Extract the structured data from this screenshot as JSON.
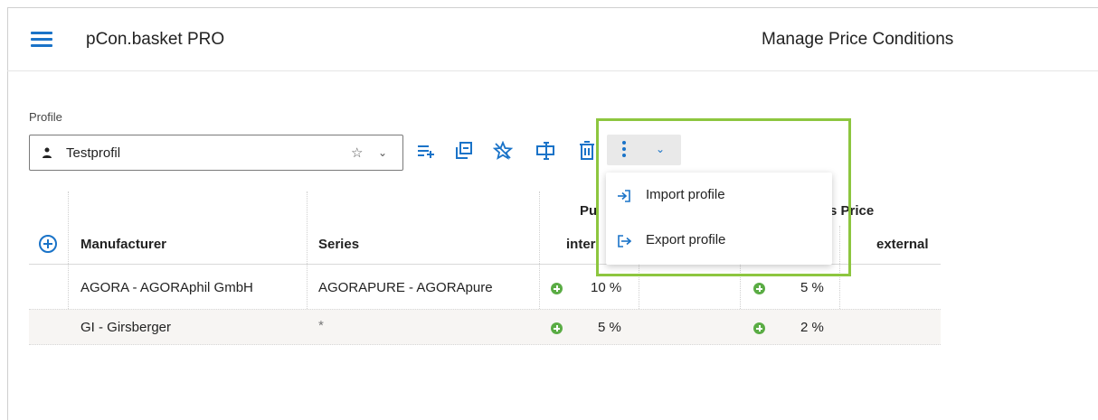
{
  "app": {
    "title": "pCon.basket PRO",
    "page_title": "Manage Price Conditions"
  },
  "profile": {
    "label": "Profile",
    "value": "Testprofil",
    "favorite_glyph": "☆",
    "chevron_glyph": "⌄"
  },
  "toolbar": {
    "more_chevron_glyph": "⌄",
    "icons": [
      "add-list-icon",
      "copy-icon",
      "unfavorite-icon",
      "rename-icon",
      "delete-icon",
      "more-vert-icon"
    ]
  },
  "menu": {
    "items": [
      {
        "label": "Import profile",
        "icon": "import-icon"
      },
      {
        "label": "Export profile",
        "icon": "export-icon"
      }
    ]
  },
  "table": {
    "group_headers": {
      "purchase": "Pu",
      "sales": "s Price"
    },
    "headers": {
      "manufacturer": "Manufacturer",
      "series": "Series",
      "purchase_internal": "inter",
      "sales_external": "external"
    },
    "rows": [
      {
        "manufacturer": "AGORA - AGORAphil GmbH",
        "series": "AGORAPURE - AGORApure",
        "purchase": "10 %",
        "sales": "5 %"
      },
      {
        "manufacturer": "GI - Girsberger",
        "series": "*",
        "purchase": "5 %",
        "sales": "2 %"
      }
    ]
  },
  "colors": {
    "accent": "#1a73c8",
    "highlight": "#8dc63f",
    "add": "#5aac44"
  }
}
